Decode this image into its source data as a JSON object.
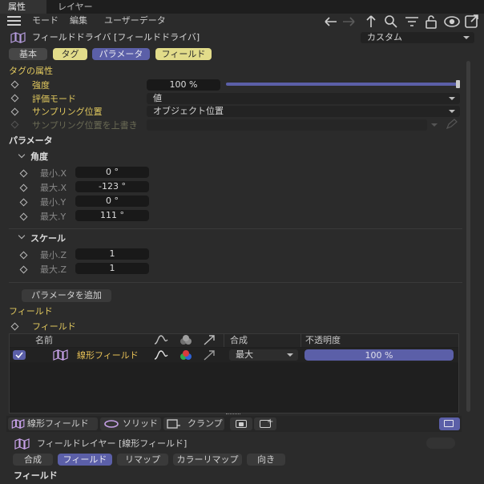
{
  "tabs": {
    "attributes": "属性",
    "layers": "レイヤー"
  },
  "menu": {
    "mode": "モード",
    "edit": "編集",
    "user_data": "ユーザーデータ"
  },
  "object": {
    "title": "フィールドドライバ [フィールドドライバ]",
    "preset": "カスタム"
  },
  "section_tabs": {
    "basic": "基本",
    "tag": "タグ",
    "parameter": "パラメータ",
    "field": "フィールド"
  },
  "tag_props": {
    "header": "タグの属性",
    "strength_label": "強度",
    "strength_value": "100 %",
    "strength_level": 1.0,
    "eval_mode_label": "評価モード",
    "eval_mode_value": "値",
    "sampling_label": "サンプリング位置",
    "sampling_value": "オブジェクト位置",
    "override_label": "サンプリング位置を上書き"
  },
  "parameters": {
    "header": "パラメータ",
    "angle_group": "角度",
    "min_x_label": "最小.X",
    "min_x_value": "0 °",
    "max_x_label": "最大.X",
    "max_x_value": "-123 °",
    "min_y_label": "最小.Y",
    "min_y_value": "0 °",
    "max_y_label": "最大.Y",
    "max_y_value": "111 °",
    "scale_group": "スケール",
    "min_z_label": "最小.Z",
    "min_z_value": "1",
    "max_z_label": "最大.Z",
    "max_z_value": "1",
    "add_button": "パラメータを追加"
  },
  "field_section": {
    "header": "フィールド",
    "sub_label": "フィールド",
    "columns": {
      "name": "名前",
      "blend": "合成",
      "opacity": "不透明度"
    },
    "rows": [
      {
        "name": "線形フィールド",
        "blend": "最大",
        "opacity": "100 %",
        "opacity_level": 1.0
      }
    ]
  },
  "bottom_toolbar": {
    "linear": "線形フィールド",
    "solid": "ソリッド",
    "clamp": "クランプ"
  },
  "layer_panel": {
    "title": "フィールドレイヤー [線形フィールド]",
    "tabs": {
      "blend": "合成",
      "field": "フィールド",
      "remap": "リマップ",
      "color_remap": "カラーリマップ",
      "direction": "向き"
    },
    "footer_header": "フィールド"
  },
  "colors": {
    "accent": "#5b5fa8",
    "tag_yellow": "#e2dc8a",
    "text_yellow": "#e2c95e",
    "panel": "#2b2b2b"
  }
}
